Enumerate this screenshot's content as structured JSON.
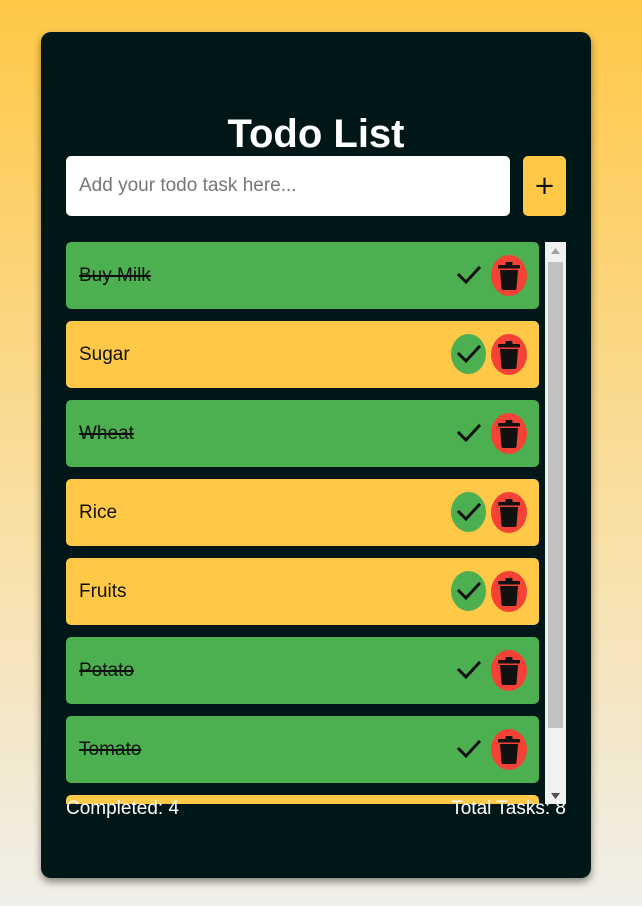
{
  "app": {
    "title": "Todo List"
  },
  "input": {
    "placeholder": "Add your todo task here...",
    "value": ""
  },
  "add_button": {
    "label": "+"
  },
  "todos": [
    {
      "text": "Buy Milk",
      "completed": true
    },
    {
      "text": "Sugar",
      "completed": false
    },
    {
      "text": "Wheat",
      "completed": true
    },
    {
      "text": "Rice",
      "completed": false
    },
    {
      "text": "Fruits",
      "completed": false
    },
    {
      "text": "Potato",
      "completed": true
    },
    {
      "text": "Tomato",
      "completed": true
    },
    {
      "text": "",
      "completed": false
    }
  ],
  "footer": {
    "completed_text": "Completed: 4",
    "total_text": "Total Tasks: 8"
  },
  "icons": {
    "check": "check-icon",
    "delete": "trash-icon",
    "scroll_up": "scroll-up-arrow-icon",
    "scroll_down": "scroll-down-arrow-icon"
  },
  "colors": {
    "background_top": "#ffc846",
    "card": "#011616",
    "completed_item": "#4caf50",
    "pending_item": "#ffc846",
    "delete": "#f44336",
    "accent": "#ffc846"
  }
}
